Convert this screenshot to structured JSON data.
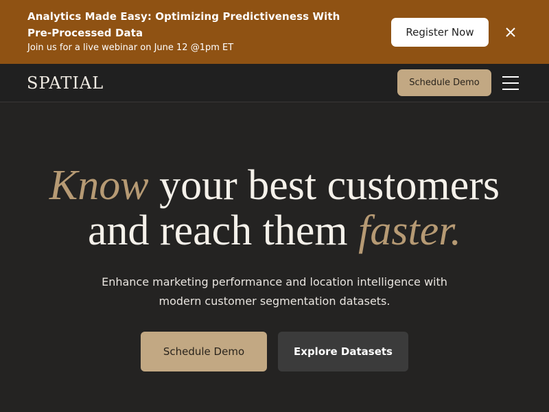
{
  "banner": {
    "title": "Analytics Made Easy: Optimizing Predictiveness With Pre-Processed Data",
    "subtitle": "Join us for a live webinar on June 12 @1pm ET",
    "register_label": "Register Now",
    "close_icon": "close-icon"
  },
  "nav": {
    "logo": "SPATIAL",
    "schedule_label": "Schedule Demo",
    "menu_icon": "menu-icon"
  },
  "hero": {
    "headline": {
      "word1": "Know",
      "middle": "your best customers",
      "line2": "and reach them",
      "word_last": "faster."
    },
    "subcopy": "Enhance marketing performance and location intelligence with modern customer segmentation datasets.",
    "primary_label": "Schedule Demo",
    "secondary_label": "Explore Datasets"
  },
  "colors": {
    "banner_bg": "#8f5213",
    "accent": "#c2a883",
    "dark_bg": "#232222",
    "button_dark": "#3b3b3b"
  }
}
